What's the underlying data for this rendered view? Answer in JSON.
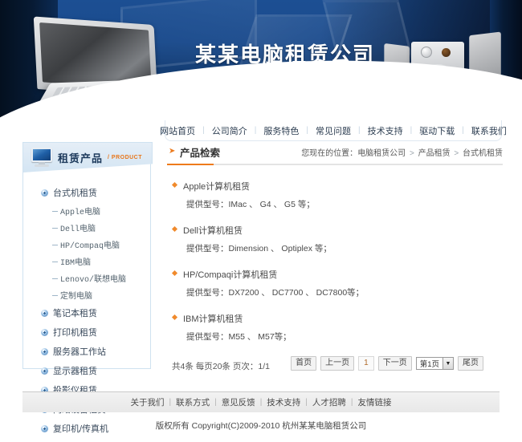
{
  "banner": {
    "title": "某某电脑租赁公司",
    "laptop_alt": "laptop-photo",
    "speakers_alt": "speakers-photo"
  },
  "nav": {
    "items": [
      {
        "label": "网站首页"
      },
      {
        "label": "公司简介"
      },
      {
        "label": "服务特色"
      },
      {
        "label": "常见问题"
      },
      {
        "label": "技术支持"
      },
      {
        "label": "驱动下载"
      },
      {
        "label": "联系我们"
      }
    ],
    "separator": "|"
  },
  "sidebar": {
    "title": "租赁产品",
    "subtitle": "/ PRODUCT",
    "icon": "monitor-icon",
    "categories": [
      {
        "label": "台式机租赁",
        "icon": "plus-circle-icon",
        "subitems": [
          {
            "label": "Apple电脑"
          },
          {
            "label": "Dell电脑"
          },
          {
            "label": "HP/Compaq电脑"
          },
          {
            "label": "IBM电脑"
          },
          {
            "label": "Lenovo/联想电脑"
          },
          {
            "label": "定制电脑"
          }
        ]
      },
      {
        "label": "笔记本租赁",
        "icon": "plus-circle-icon",
        "subitems": []
      },
      {
        "label": "打印机租赁",
        "icon": "plus-circle-icon",
        "subitems": []
      },
      {
        "label": "服务器工作站",
        "icon": "plus-circle-icon",
        "subitems": []
      },
      {
        "label": "显示器租赁",
        "icon": "plus-circle-icon",
        "subitems": []
      },
      {
        "label": "投影仪租赁",
        "icon": "plus-circle-icon",
        "subitems": []
      },
      {
        "label": "网络设备租赁",
        "icon": "plus-circle-icon",
        "subitems": []
      },
      {
        "label": "复印机/传真机",
        "icon": "plus-circle-icon",
        "subitems": []
      }
    ]
  },
  "content": {
    "title": "产品检索",
    "title_icon": "orange-arrow-icon",
    "breadcrumb": {
      "prefix": "您现在的位置：",
      "items": [
        "电脑租赁公司",
        "产品租赁",
        "台式机租赁"
      ],
      "separator": ">"
    },
    "products": [
      {
        "name": "Apple计算机租赁",
        "models": "提供型号：IMac 、  G4 、  G5 等；"
      },
      {
        "name": "Dell计算机租赁",
        "models": "提供型号：Dimension 、  Optiplex 等；"
      },
      {
        "name": "HP/Compaqi计算机租赁",
        "models": "提供型号：DX7200 、  DC7700 、  DC7800等；"
      },
      {
        "name": "IBM计算机租赁",
        "models": "提供型号：M55 、 M57等；"
      }
    ],
    "pager": {
      "info": "共4条 每页20条 页次：1/1",
      "first": "首页",
      "prev": "上一页",
      "current": "1",
      "next": "下一页",
      "select_value": "第1页",
      "select_arrow": "▼",
      "last": "尾页"
    }
  },
  "footer": {
    "links": [
      {
        "label": "关于我们"
      },
      {
        "label": "联系方式"
      },
      {
        "label": "意见反馈"
      },
      {
        "label": "技术支持"
      },
      {
        "label": "人才招聘"
      },
      {
        "label": "友情链接"
      }
    ],
    "separator": "|",
    "copyright": "版权所有  Copyright(C)2009-2010 杭州某某电脑租赁公司"
  },
  "colors": {
    "banner_blue": "#1a4a8c",
    "accent_orange": "#ee7a1b",
    "sidebar_border": "#cfe2f0",
    "text_dark": "#333333"
  }
}
